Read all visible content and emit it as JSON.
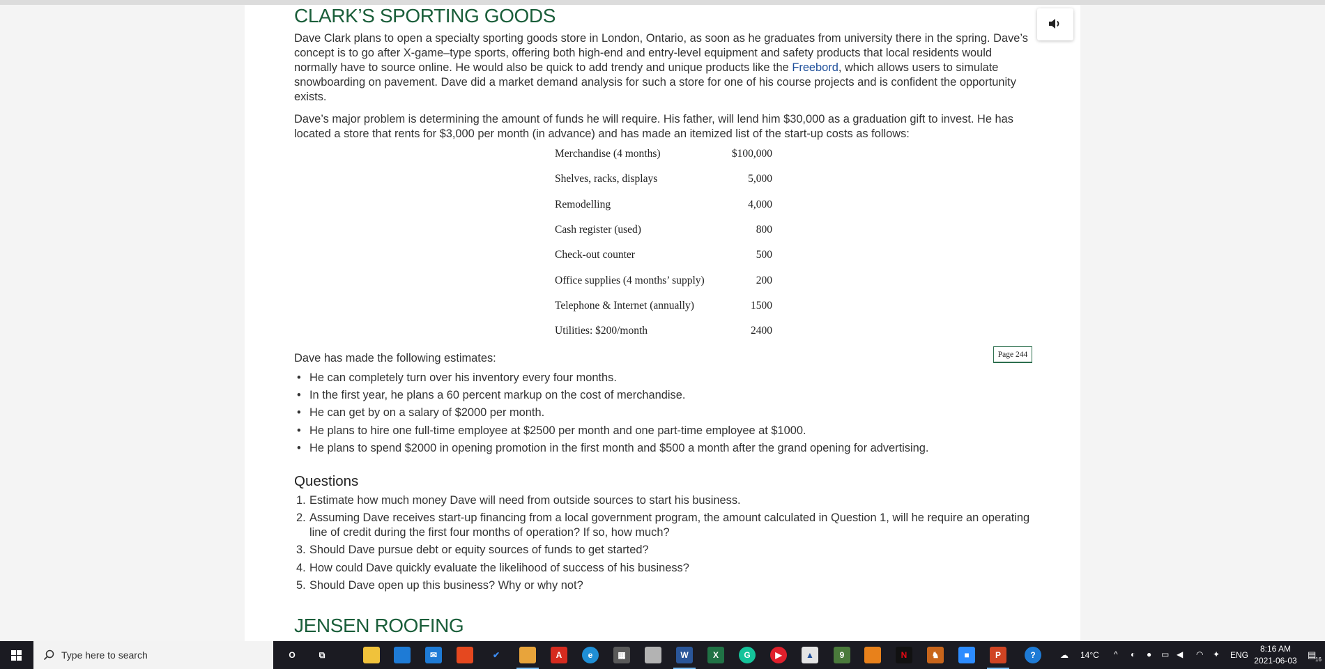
{
  "heading": "CLARK’S SPORTING GOODS",
  "intro": {
    "before_link": "Dave Clark plans to open a specialty sporting goods store in London, Ontario, as soon as he graduates from university there in the spring. Dave’s concept is to go after X-game–type sports, offering both high-end and entry-level equipment and safety products that local residents would normally have to source online. He would also be quick to add trendy and unique products like the ",
    "link": "Freebord",
    "after_link": ", which allows users to simulate snowboarding on pavement. Dave did a market demand analysis for such a store for one of his course projects and is confident the opportunity exists."
  },
  "problem": "Dave’s major problem is determining the amount of funds he will require. His father, will lend him $30,000 as a graduation gift to invest. He has located a store that rents for $3,000 per month (in advance) and has made an itemized list of the start-up costs as follows:",
  "costs": [
    {
      "item": "Merchandise (4 months)",
      "amount": "$100,000"
    },
    {
      "item": "Shelves, racks, displays",
      "amount": "5,000"
    },
    {
      "item": "Remodelling",
      "amount": "4,000"
    },
    {
      "item": "Cash register (used)",
      "amount": "800"
    },
    {
      "item": "Check-out counter",
      "amount": "500"
    },
    {
      "item": "Office supplies (4 months’ supply)",
      "amount": "200"
    },
    {
      "item": "Telephone & Internet (annually)",
      "amount": "1500"
    },
    {
      "item": "Utilities: $200/month",
      "amount": "2400"
    }
  ],
  "page_badge": "Page 244",
  "estimates_intro": "Dave has made the following estimates:",
  "estimates": [
    "He can completely turn over his inventory every four months.",
    "In the first year, he plans a 60 percent markup on the cost of merchandise.",
    "He can get by on a salary of $2000 per month.",
    "He plans to hire one full-time employee at $2500 per month and one part-time employee at $1000.",
    "He plans to spend $2000 in opening promotion in the first month and $500 a month after the grand opening for advertising."
  ],
  "questions_title": "Questions",
  "questions": [
    {
      "num": "1.",
      "text": "Estimate how much money Dave will need from outside sources to start his business."
    },
    {
      "num": "2.",
      "text": "Assuming Dave receives start-up financing from a local government program, the amount calculated in Question 1, will he require an operating line of credit during the first four months of operation? If so, how much?"
    },
    {
      "num": "3.",
      "text": "Should Dave pursue debt or equity sources of funds to get started?"
    },
    {
      "num": "4.",
      "text": "How could Dave quickly evaluate the likelihood of success of his business?"
    },
    {
      "num": "5.",
      "text": "Should Dave open up this business? Why or why not?"
    }
  ],
  "next_heading": "JENSEN ROOFING",
  "audio_button_icon": "speaker-icon",
  "colors": {
    "heading": "#1a5e3a",
    "link": "#1d4e9a",
    "taskbar": "#1b1b22"
  },
  "taskbar": {
    "search_placeholder": "Type here to search",
    "apps": [
      {
        "name": "cortana-icon",
        "glyph": "O"
      },
      {
        "name": "task-view-icon",
        "glyph": "⧉"
      },
      {
        "name": "file-explorer-icon",
        "glyph": ""
      },
      {
        "name": "store-icon",
        "glyph": ""
      },
      {
        "name": "mail-icon",
        "glyph": "✉"
      },
      {
        "name": "office-icon",
        "glyph": ""
      },
      {
        "name": "todo-icon",
        "glyph": "✔"
      },
      {
        "name": "chrome-icon",
        "glyph": ""
      },
      {
        "name": "acrobat-icon",
        "glyph": "A"
      },
      {
        "name": "edge-icon",
        "glyph": "e"
      },
      {
        "name": "calculator-icon",
        "glyph": "▦"
      },
      {
        "name": "paint-icon",
        "glyph": ""
      },
      {
        "name": "word-icon",
        "glyph": "W"
      },
      {
        "name": "excel-icon",
        "glyph": "X"
      },
      {
        "name": "grammarly-icon",
        "glyph": "G"
      },
      {
        "name": "media-player-icon",
        "glyph": "▶"
      },
      {
        "name": "photos-icon",
        "glyph": "▲"
      },
      {
        "name": "app-9-icon",
        "glyph": "9"
      },
      {
        "name": "orange-app-icon",
        "glyph": ""
      },
      {
        "name": "netflix-icon",
        "glyph": "N"
      },
      {
        "name": "game-icon",
        "glyph": "♞"
      },
      {
        "name": "zoom-icon",
        "glyph": "■"
      },
      {
        "name": "powerpoint-icon",
        "glyph": "P"
      },
      {
        "name": "help-icon",
        "glyph": "?"
      }
    ],
    "temperature": "14°C",
    "language": "ENG",
    "time": "8:16 AM",
    "date": "2021-06-03",
    "notification_count": "16"
  }
}
